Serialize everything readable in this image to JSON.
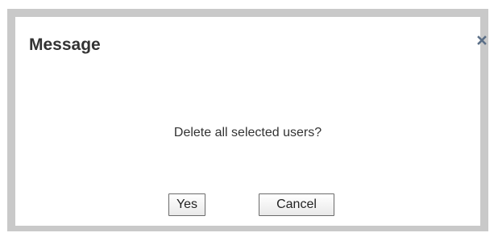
{
  "dialog": {
    "title": "Message",
    "close_icon": "close-icon",
    "message": "Delete all selected users?",
    "buttons": {
      "yes_label": "Yes",
      "cancel_label": "Cancel"
    },
    "colors": {
      "border": "#c9c9c9",
      "close_icon": "#5b6f87",
      "text": "#333333"
    }
  }
}
